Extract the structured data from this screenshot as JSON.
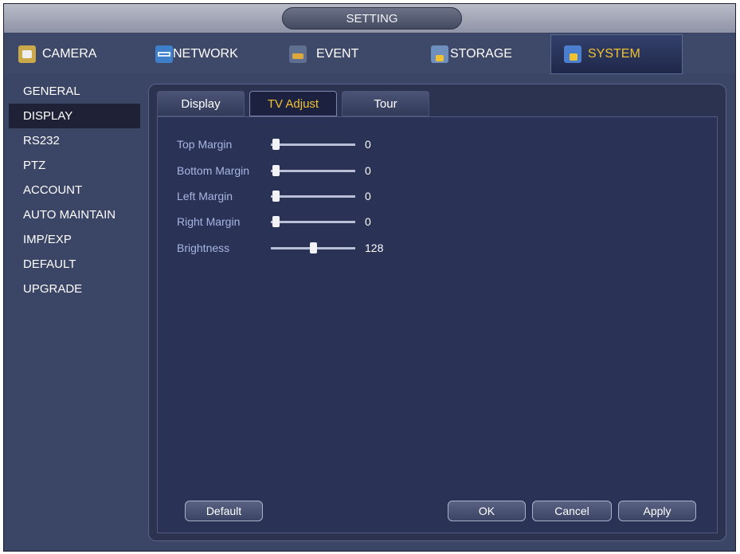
{
  "window": {
    "title": "SETTING"
  },
  "main_tabs": [
    {
      "label": "CAMERA",
      "icon": "camera-icon"
    },
    {
      "label": "NETWORK",
      "icon": "network-icon"
    },
    {
      "label": "EVENT",
      "icon": "event-icon"
    },
    {
      "label": "STORAGE",
      "icon": "storage-icon"
    },
    {
      "label": "SYSTEM",
      "icon": "system-icon",
      "active": true
    }
  ],
  "sidebar": {
    "items": [
      {
        "label": "GENERAL"
      },
      {
        "label": "DISPLAY",
        "active": true
      },
      {
        "label": "RS232"
      },
      {
        "label": "PTZ"
      },
      {
        "label": "ACCOUNT"
      },
      {
        "label": "AUTO MAINTAIN"
      },
      {
        "label": "IMP/EXP"
      },
      {
        "label": "DEFAULT"
      },
      {
        "label": "UPGRADE"
      }
    ]
  },
  "sub_tabs": [
    {
      "label": "Display"
    },
    {
      "label": "TV Adjust",
      "active": true
    },
    {
      "label": "Tour"
    }
  ],
  "settings": [
    {
      "label": "Top Margin",
      "value": "0",
      "level": 0.0
    },
    {
      "label": "Bottom Margin",
      "value": "0",
      "level": 0.0
    },
    {
      "label": "Left Margin",
      "value": "0",
      "level": 0.0
    },
    {
      "label": "Right Margin",
      "value": "0",
      "level": 0.0
    },
    {
      "label": "Brightness",
      "value": "128",
      "level": 0.5
    }
  ],
  "buttons": {
    "default": "Default",
    "ok": "OK",
    "cancel": "Cancel",
    "apply": "Apply"
  },
  "colors": {
    "accent": "#f0c230",
    "label": "#a7b6e3",
    "background": "#2a3255"
  }
}
